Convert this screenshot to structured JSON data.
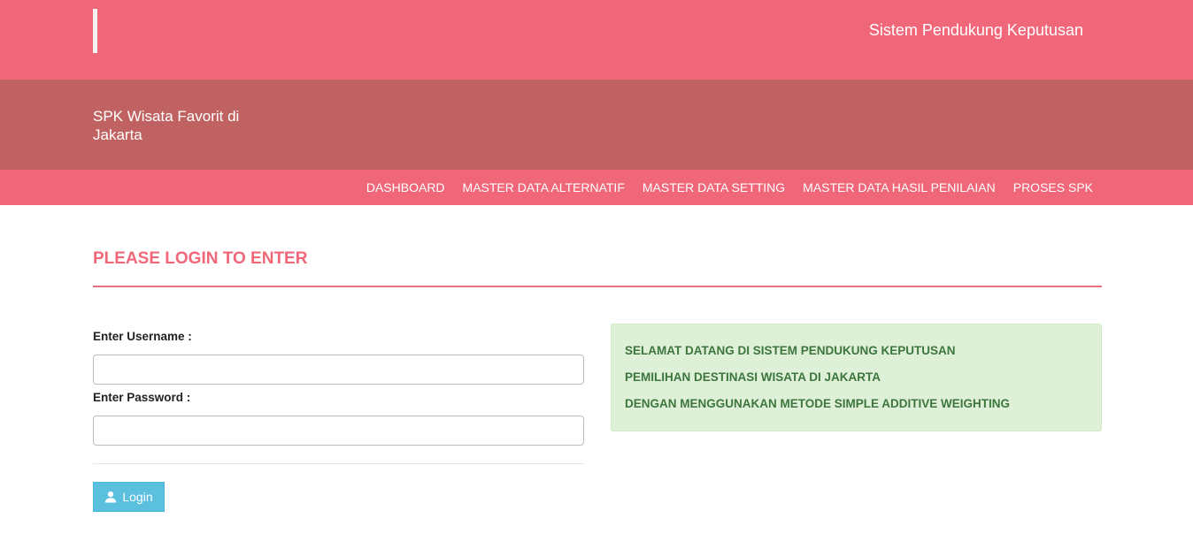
{
  "header": {
    "site_title": "Sistem Pendukung Keputusan"
  },
  "banner": {
    "brand": "SPK Wisata Favorit di Jakarta"
  },
  "nav": {
    "items": [
      "DASHBOARD",
      "MASTER DATA ALTERNATIF",
      "MASTER DATA SETTING",
      "MASTER DATA HASIL PENILAIAN",
      "PROSES SPK"
    ]
  },
  "login": {
    "heading": "PLEASE LOGIN TO ENTER",
    "username_label": "Enter Username :",
    "username_value": "",
    "password_label": "Enter Password :",
    "password_value": "",
    "button_label": "Login",
    "button_icon": "user-icon"
  },
  "welcome": {
    "lines": [
      "SELAMAT DATANG DI SISTEM PENDUKUNG KEPUTUSAN",
      "PEMILIHAN DESTINASI WISATA DI JAKARTA",
      "DENGAN MENGGUNAKAN METODE SIMPLE ADDITIVE WEIGHTING"
    ]
  },
  "colors": {
    "primary": "#f0677a",
    "banner": "#c06262",
    "info_button": "#5bc0de",
    "success_bg": "#dff0d8",
    "success_text": "#3c763d"
  }
}
